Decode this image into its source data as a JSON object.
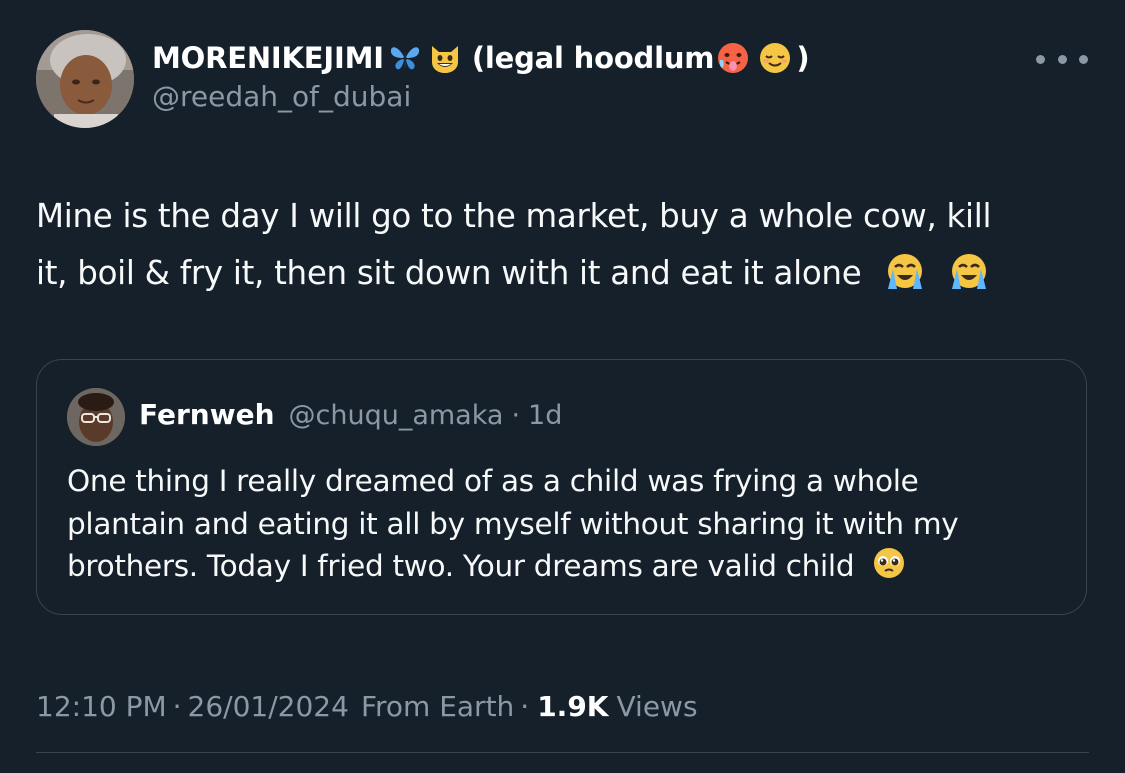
{
  "tweet": {
    "author": {
      "name": "MORENIKEJIMI",
      "name_suffix": "(legal hoodlum",
      "name_close": ")",
      "handle": "@reedah_of_dubai",
      "emoji_names": [
        "butterfly-emoji",
        "grinning-cat-emoji",
        "hot-face-emoji",
        "relieved-face-emoji"
      ]
    },
    "text_lines": [
      "Mine is the day I will go to the market, buy a whole cow, kill",
      "it, boil & fry it, then sit down with it and eat it alone"
    ],
    "text_emojis": [
      "loudly-crying-face-emoji",
      "loudly-crying-face-emoji"
    ],
    "quote": {
      "name": "Fernweh",
      "handle": "@chuqu_amaka",
      "separator": "·",
      "time": "1d",
      "text_lines": [
        "One thing I really dreamed of as a child was frying a whole",
        "plantain and eating it all by myself without sharing it with my",
        "brothers. Today I fried two. Your dreams are valid child"
      ],
      "text_emoji": "pleading-face-emoji"
    },
    "meta": {
      "time": "12:10 PM",
      "separator": "·",
      "date": "26/01/2024",
      "location": "From Earth",
      "views_count": "1.9K",
      "views_label": "Views"
    }
  },
  "colors": {
    "background": "#15202b",
    "primary_text": "#f7f9f9",
    "secondary_text": "#8b98a5",
    "border": "#38444d"
  }
}
